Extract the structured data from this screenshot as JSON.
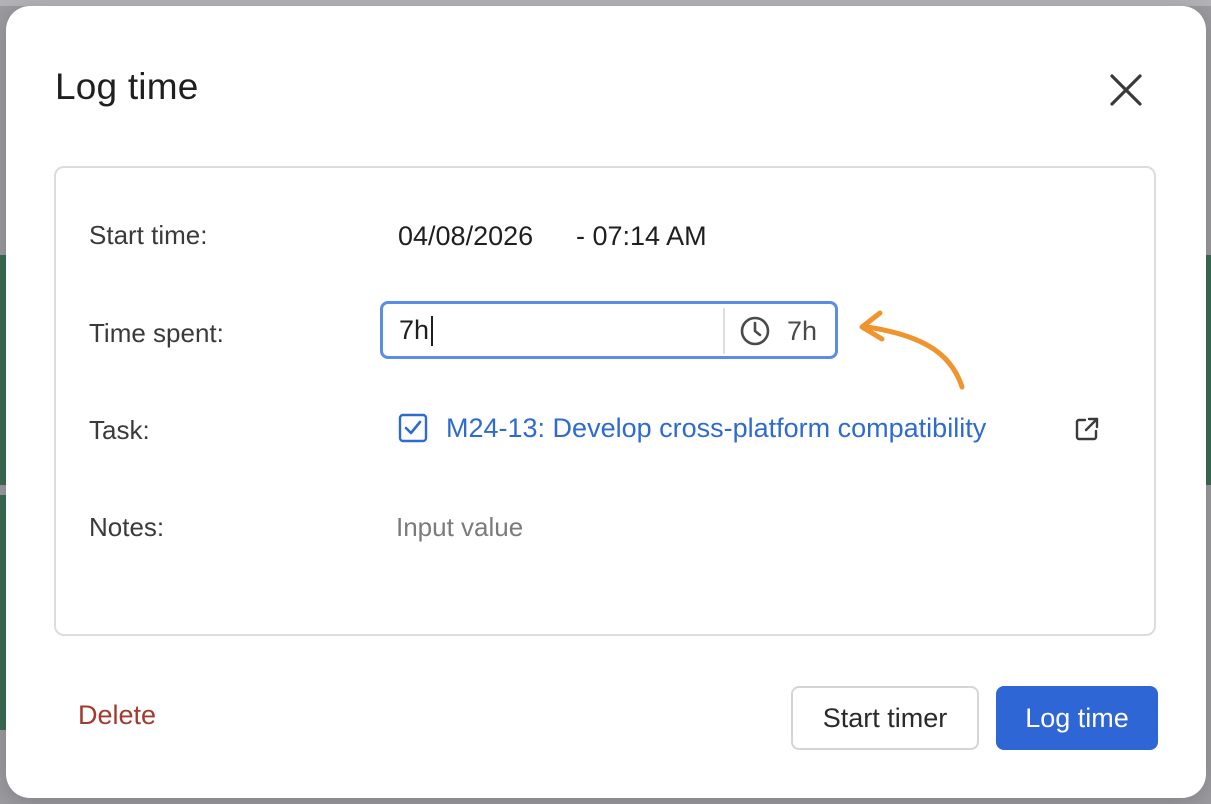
{
  "dialog": {
    "title": "Log time",
    "close_icon": "close-icon"
  },
  "form": {
    "start_time": {
      "label": "Start time:",
      "date": "04/08/2026",
      "time": "- 07:14 AM"
    },
    "time_spent": {
      "label": "Time spent:",
      "value": "7h",
      "summary_icon": "clock-icon",
      "summary": "7h"
    },
    "task": {
      "label": "Task:",
      "icon": "checkbox-checked-icon",
      "name": "M24-13: Develop cross-platform compatibility",
      "open_icon": "external-link-icon"
    },
    "notes": {
      "label": "Notes:",
      "placeholder": "Input value",
      "value": ""
    }
  },
  "footer": {
    "delete_label": "Delete",
    "start_timer_label": "Start timer",
    "log_time_label": "Log time"
  },
  "colors": {
    "accent": "#2f66d6",
    "focus_border": "#5b8de6",
    "link": "#2e6bd1",
    "danger": "#a33a2f",
    "annotation": "#f0952e"
  }
}
